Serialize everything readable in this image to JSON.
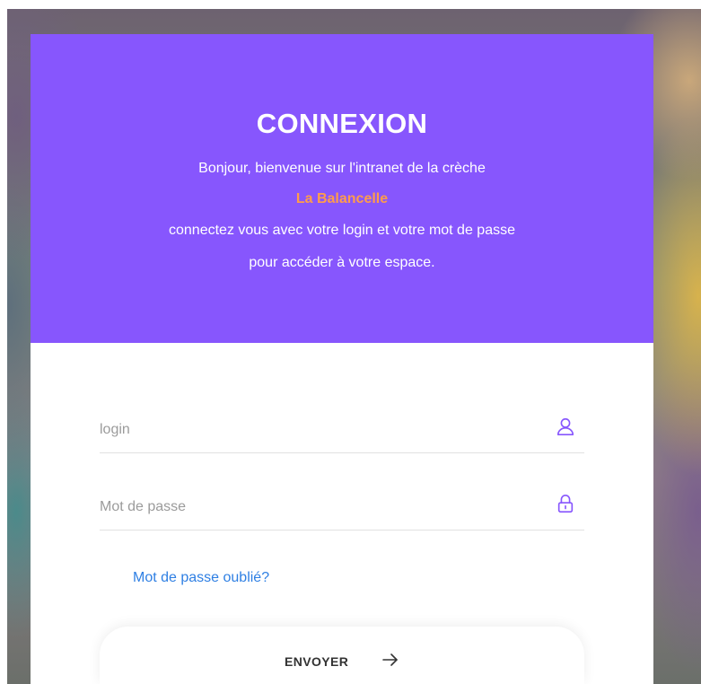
{
  "header": {
    "title": "CONNEXION",
    "line1": "Bonjour, bienvenue sur l'intranet de la crèche",
    "brand": "La Balancelle",
    "line3": "connectez vous avec votre login et votre mot de passe",
    "line4": "pour accéder à votre espace."
  },
  "form": {
    "login_placeholder": "login",
    "password_placeholder": "Mot de passe",
    "forgot_label": "Mot de passe oublié?",
    "submit_label": "ENVOYER"
  },
  "icons": {
    "login": "user-icon",
    "password": "lock-icon",
    "submit": "arrow-right-icon"
  },
  "colors": {
    "header_bg": "#8756fd",
    "brand": "#ff9c4b",
    "link": "#2e7fe3",
    "icon": "#8756fd"
  }
}
